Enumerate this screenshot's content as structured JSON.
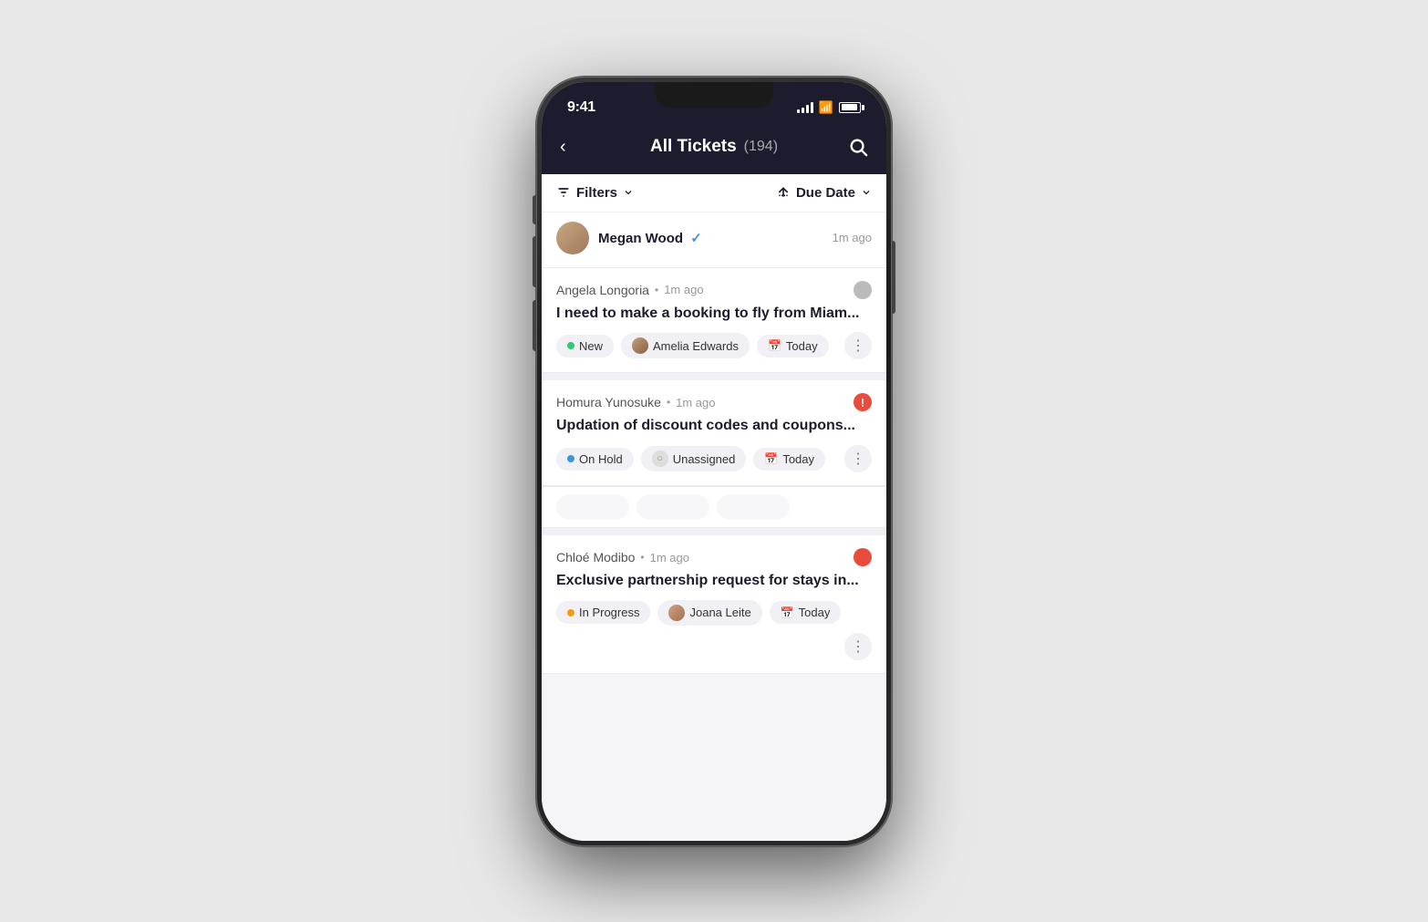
{
  "phone": {
    "status_bar": {
      "time": "9:41",
      "signal": "4 bars",
      "wifi": "on",
      "battery": "full"
    },
    "header": {
      "back_label": "<",
      "title": "All Tickets",
      "count": "(194)",
      "search_label": "search"
    },
    "filter_bar": {
      "filter_label": "Filters",
      "sort_label": "Due Date"
    },
    "tickets": {
      "partial_top": {
        "name": "Megan Wood",
        "verified": true,
        "time": "1m ago"
      },
      "ticket1": {
        "submitter": "Angela Longoria",
        "time": "1m ago",
        "priority": "normal",
        "title": "I need to make a booking to fly from Miam...",
        "status_label": "New",
        "status_dot": "new",
        "assignee": "Amelia Edwards",
        "due_date": "Today",
        "more_label": "⋯"
      },
      "ticket2": {
        "submitter": "Homura Yunosuke",
        "time": "1m ago",
        "priority": "urgent",
        "title": "Updation of discount codes and coupons...",
        "status_label": "On Hold",
        "status_dot": "onhold",
        "assignee": "Unassigned",
        "due_date": "Today",
        "more_label": "⋯"
      },
      "ticket3": {
        "submitter": "Chloé Modibo",
        "time": "1m ago",
        "priority": "red",
        "title": "Exclusive partnership request for stays in...",
        "status_label": "In Progress",
        "status_dot": "inprogress",
        "assignee": "Joana Leite",
        "due_date": "Today",
        "more_label": "⋯"
      }
    }
  }
}
